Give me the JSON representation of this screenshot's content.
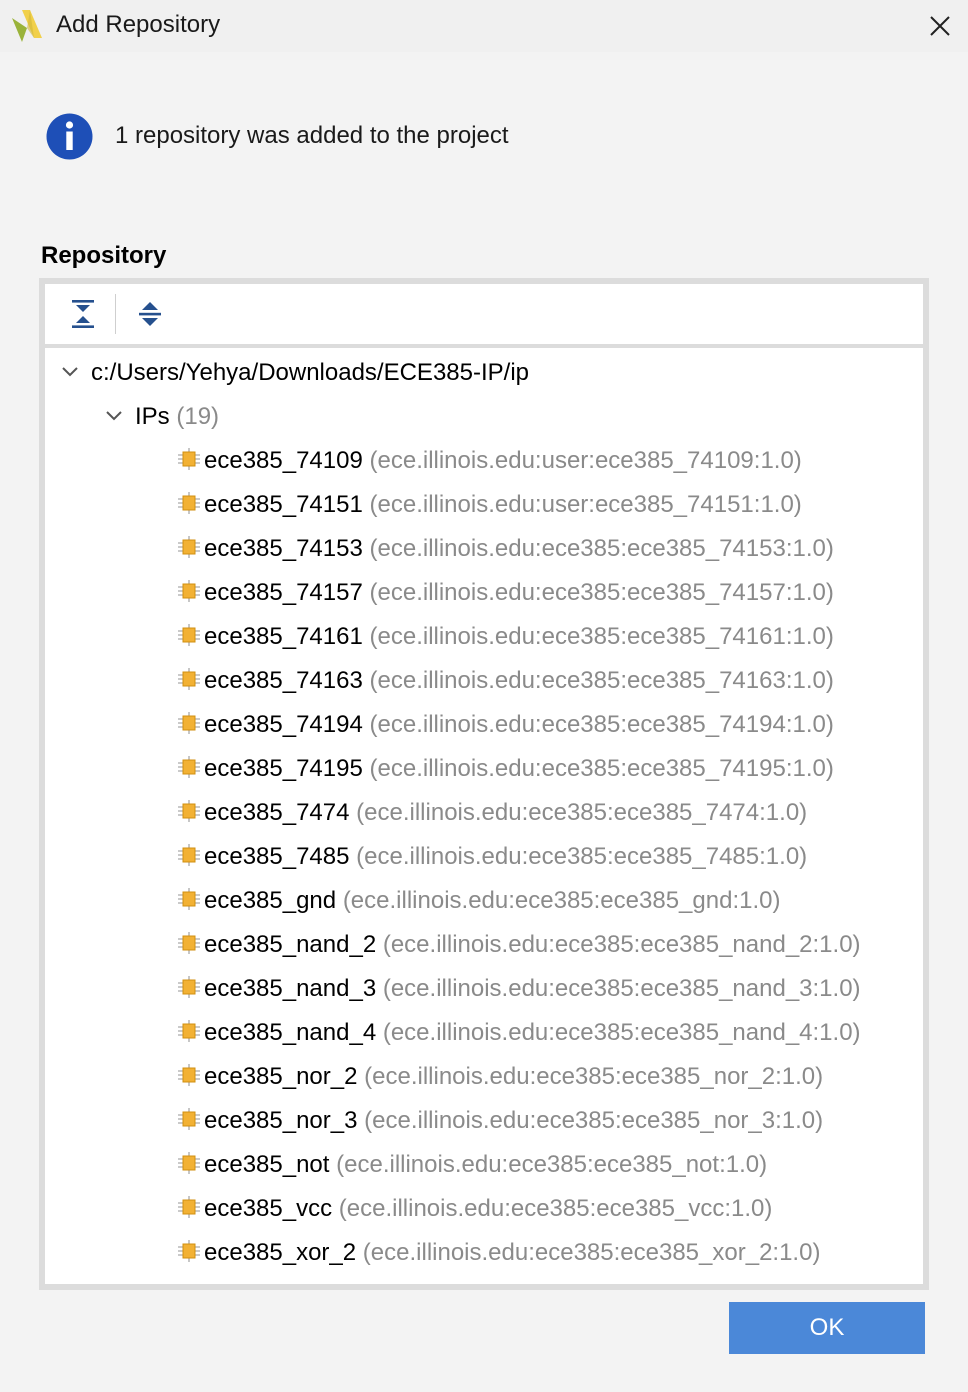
{
  "window": {
    "title": "Add Repository"
  },
  "message": {
    "text": "1 repository was added to the project"
  },
  "repository": {
    "label": "Repository",
    "root_path": "c:/Users/Yehya/Downloads/ECE385-IP/ip",
    "ips_label": "IPs",
    "ips_count": "(19)",
    "items": [
      {
        "name": "ece385_74109",
        "vlnv": "(ece.illinois.edu:user:ece385_74109:1.0)"
      },
      {
        "name": "ece385_74151",
        "vlnv": "(ece.illinois.edu:user:ece385_74151:1.0)"
      },
      {
        "name": "ece385_74153",
        "vlnv": "(ece.illinois.edu:ece385:ece385_74153:1.0)"
      },
      {
        "name": "ece385_74157",
        "vlnv": "(ece.illinois.edu:ece385:ece385_74157:1.0)"
      },
      {
        "name": "ece385_74161",
        "vlnv": "(ece.illinois.edu:ece385:ece385_74161:1.0)"
      },
      {
        "name": "ece385_74163",
        "vlnv": "(ece.illinois.edu:ece385:ece385_74163:1.0)"
      },
      {
        "name": "ece385_74194",
        "vlnv": "(ece.illinois.edu:ece385:ece385_74194:1.0)"
      },
      {
        "name": "ece385_74195",
        "vlnv": "(ece.illinois.edu:ece385:ece385_74195:1.0)"
      },
      {
        "name": "ece385_7474",
        "vlnv": "(ece.illinois.edu:ece385:ece385_7474:1.0)"
      },
      {
        "name": "ece385_7485",
        "vlnv": "(ece.illinois.edu:ece385:ece385_7485:1.0)"
      },
      {
        "name": "ece385_gnd",
        "vlnv": "(ece.illinois.edu:ece385:ece385_gnd:1.0)"
      },
      {
        "name": "ece385_nand_2",
        "vlnv": "(ece.illinois.edu:ece385:ece385_nand_2:1.0)"
      },
      {
        "name": "ece385_nand_3",
        "vlnv": "(ece.illinois.edu:ece385:ece385_nand_3:1.0)"
      },
      {
        "name": "ece385_nand_4",
        "vlnv": "(ece.illinois.edu:ece385:ece385_nand_4:1.0)"
      },
      {
        "name": "ece385_nor_2",
        "vlnv": "(ece.illinois.edu:ece385:ece385_nor_2:1.0)"
      },
      {
        "name": "ece385_nor_3",
        "vlnv": "(ece.illinois.edu:ece385:ece385_nor_3:1.0)"
      },
      {
        "name": "ece385_not",
        "vlnv": "(ece.illinois.edu:ece385:ece385_not:1.0)"
      },
      {
        "name": "ece385_vcc",
        "vlnv": "(ece.illinois.edu:ece385:ece385_vcc:1.0)"
      },
      {
        "name": "ece385_xor_2",
        "vlnv": "(ece.illinois.edu:ece385:ece385_xor_2:1.0)"
      }
    ]
  },
  "buttons": {
    "ok_label": "OK"
  },
  "icons": {
    "app": "vivado-logo-icon",
    "close": "close-icon",
    "info": "info-icon",
    "collapse_all": "collapse-all-icon",
    "expand_all": "expand-all-icon",
    "ip": "ip-core-icon"
  },
  "colors": {
    "accent": "#4b88d8",
    "info_blue": "#1e4fb7",
    "ip_icon": "#f2b134",
    "secondary_text": "#8a8a8a"
  }
}
